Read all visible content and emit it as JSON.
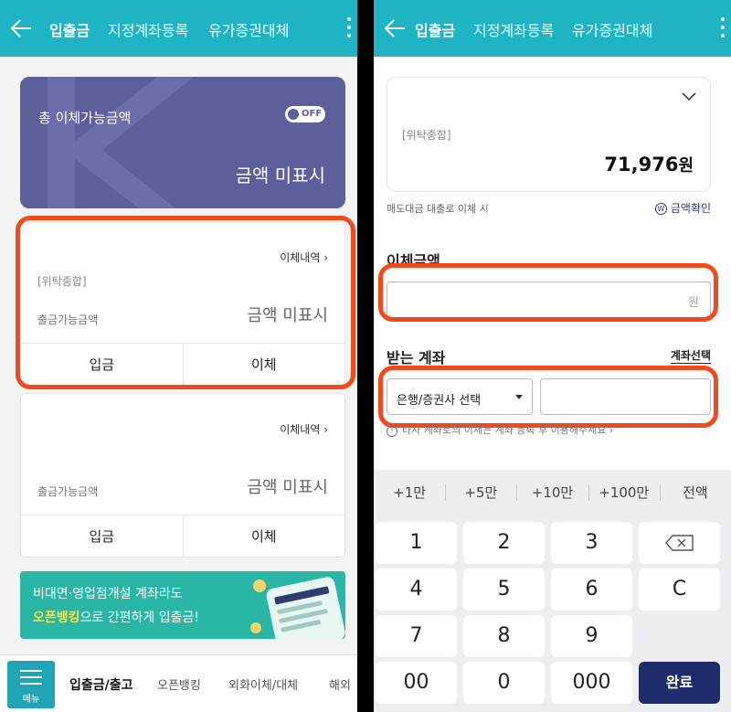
{
  "left": {
    "tabs": [
      "입출금",
      "지정계좌등록",
      "유가증권대체"
    ],
    "balance_card": {
      "title": "총 이체가능금액",
      "toggle_label": "OFF",
      "amount": "금액 미표시"
    },
    "accounts": [
      {
        "history_link": "이체내역",
        "account_type": "[위탁종합]",
        "available_label": "출금가능금액",
        "available_value": "금액 미표시",
        "deposit_label": "입금",
        "transfer_label": "이체"
      },
      {
        "history_link": "이체내역",
        "account_type": "",
        "available_label": "출금가능금액",
        "available_value": "금액 미표시",
        "deposit_label": "입금",
        "transfer_label": "이체"
      }
    ],
    "banner": {
      "line1": "비대면·영업점개설 계좌라도",
      "line2_highlight": "오픈뱅킹",
      "line2_rest": "으로 간편하게 입출금!"
    },
    "bottom_nav": {
      "menu_label": "메뉴",
      "items": [
        "입출금/출고",
        "오픈뱅킹",
        "외화이체/대체",
        "해외"
      ]
    }
  },
  "right": {
    "tabs": [
      "입출금",
      "지정계좌등록",
      "유가증권대체"
    ],
    "account": {
      "type": "[위탁종합]",
      "balance": "71,976",
      "currency": "원"
    },
    "sale_note": "매도대금 대출로 이체 시",
    "confirm_link": "금액확인",
    "confirm_icon": "W",
    "amount_label": "이체금액",
    "amount_unit": "원",
    "receive_label": "받는 계좌",
    "account_select_link": "계좌선택",
    "bank_select": "은행/증권사 선택",
    "warning": "타사 계좌로의 이체는 계좌 등록 후 이용해주세요",
    "quick_amounts": [
      "+1만",
      "+5만",
      "+10만",
      "+100만",
      "전액"
    ],
    "keys": [
      "1",
      "2",
      "3",
      "4",
      "5",
      "6",
      "C",
      "7",
      "8",
      "9",
      "00",
      "0",
      "000"
    ],
    "done_label": "완료"
  },
  "colors": {
    "topbar": "#1fb4c4",
    "balance_card": "#5c5f9a",
    "highlight": "#f24a1c",
    "banner": "#29b6a5",
    "done_key": "#1f2c6b"
  }
}
